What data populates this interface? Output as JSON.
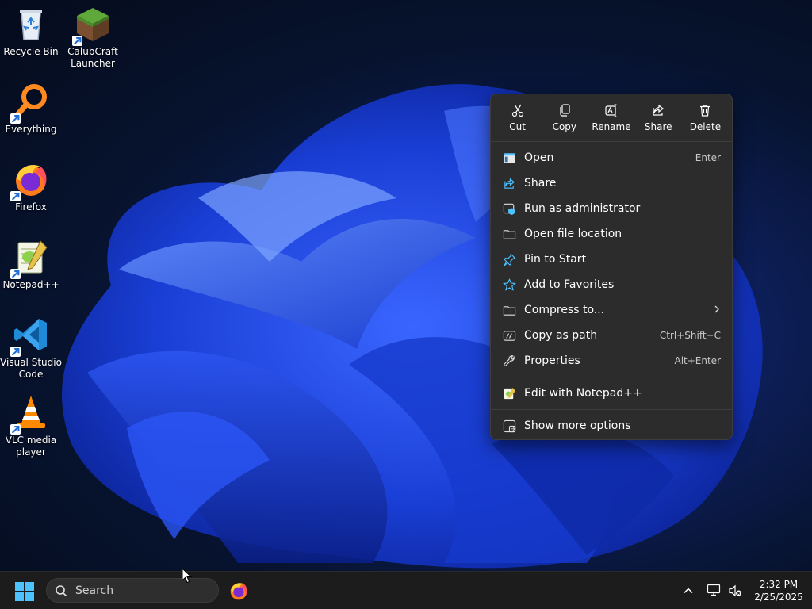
{
  "desktop": {
    "icons": [
      {
        "label": "Recycle Bin",
        "icon": "recycle-bin-icon"
      },
      {
        "label": "CalubCraft Launcher",
        "icon": "minecraft-grass-block-icon"
      },
      {
        "label": "Everything",
        "icon": "everything-search-icon"
      },
      {
        "label": "Firefox",
        "icon": "firefox-icon"
      },
      {
        "label": "Notepad++",
        "icon": "notepad-plus-plus-icon"
      },
      {
        "label": "Visual Studio Code",
        "icon": "vscode-icon"
      },
      {
        "label": "VLC media player",
        "icon": "vlc-cone-icon"
      }
    ]
  },
  "context_menu": {
    "quick_actions": [
      {
        "label": "Cut",
        "icon": "scissors-icon"
      },
      {
        "label": "Copy",
        "icon": "copy-icon"
      },
      {
        "label": "Rename",
        "icon": "rename-icon"
      },
      {
        "label": "Share",
        "icon": "share-icon"
      },
      {
        "label": "Delete",
        "icon": "trash-icon"
      }
    ],
    "items": [
      {
        "label": "Open",
        "shortcut": "Enter",
        "icon": "open-window-icon"
      },
      {
        "label": "Share",
        "shortcut": "",
        "icon": "share-icon"
      },
      {
        "label": "Run as administrator",
        "shortcut": "",
        "icon": "shield-window-icon"
      },
      {
        "label": "Open file location",
        "shortcut": "",
        "icon": "folder-icon"
      },
      {
        "label": "Pin to Start",
        "shortcut": "",
        "icon": "pin-icon"
      },
      {
        "label": "Add to Favorites",
        "shortcut": "",
        "icon": "star-icon"
      },
      {
        "label": "Compress to...",
        "shortcut": "",
        "icon": "zip-folder-icon"
      },
      {
        "label": "Copy as path",
        "shortcut": "Ctrl+Shift+C",
        "icon": "copy-path-icon"
      },
      {
        "label": "Properties",
        "shortcut": "Alt+Enter",
        "icon": "wrench-icon"
      }
    ],
    "extra_items": [
      {
        "label": "Edit with Notepad++",
        "icon": "notepad-plus-plus-icon"
      }
    ],
    "more_item": {
      "label": "Show more options",
      "icon": "more-options-icon"
    }
  },
  "taskbar": {
    "search_placeholder": "Search",
    "clock_time": "2:32 PM",
    "clock_date": "2/25/2025"
  },
  "colors": {
    "menu_bg": "#2c2c2c",
    "taskbar_bg": "#1c1c1c",
    "accent": "#4cc2ff"
  }
}
